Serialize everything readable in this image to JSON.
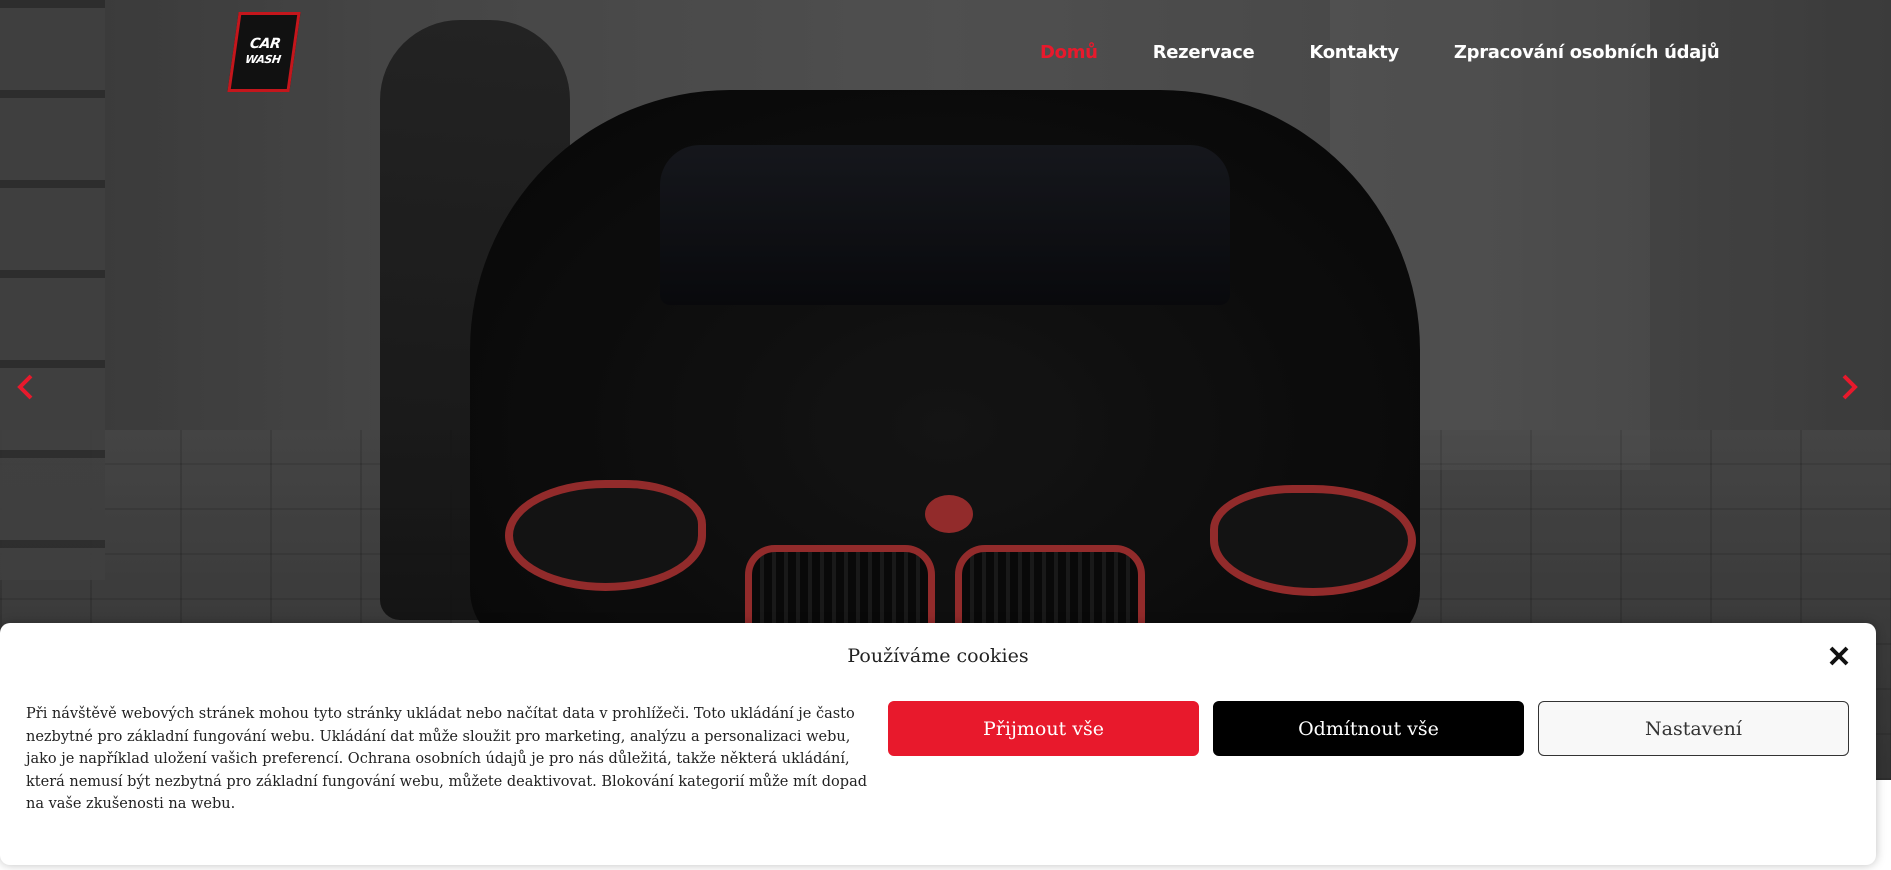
{
  "logo": {
    "line1": "CAR",
    "line2": "WASH"
  },
  "nav": {
    "items": [
      {
        "label": "Domů",
        "active": true
      },
      {
        "label": "Rezervace",
        "active": false
      },
      {
        "label": "Kontakty",
        "active": false
      },
      {
        "label": "Zpracování osobních údajů",
        "active": false
      }
    ]
  },
  "slider": {
    "prev_icon": "chevron-left-icon",
    "next_icon": "chevron-right-icon"
  },
  "cookie": {
    "title": "Používáme cookies",
    "text": "Při návštěvě webových stránek mohou tyto stránky ukládat nebo načítat data v prohlížeči. Toto ukládání je často nezbytné pro základní fungování webu. Ukládání dat může sloužit pro marketing, analýzu a personalizaci webu, jako je například uložení vašich preferencí. Ochrana osobních údajů je pro nás důležitá, takže některá ukládání, která nemusí být nezbytná pro základní fungování webu, můžete deaktivovat. Blokování kategorií může mít dopad na vaše zkušenosti na webu.",
    "accept_label": "Přijmout vše",
    "deny_label": "Odmítnout vše",
    "settings_label": "Nastavení",
    "close_icon": "close-icon"
  },
  "colors": {
    "accent": "#e8192c",
    "nav_text": "#ffffff",
    "deny_bg": "#000000"
  }
}
